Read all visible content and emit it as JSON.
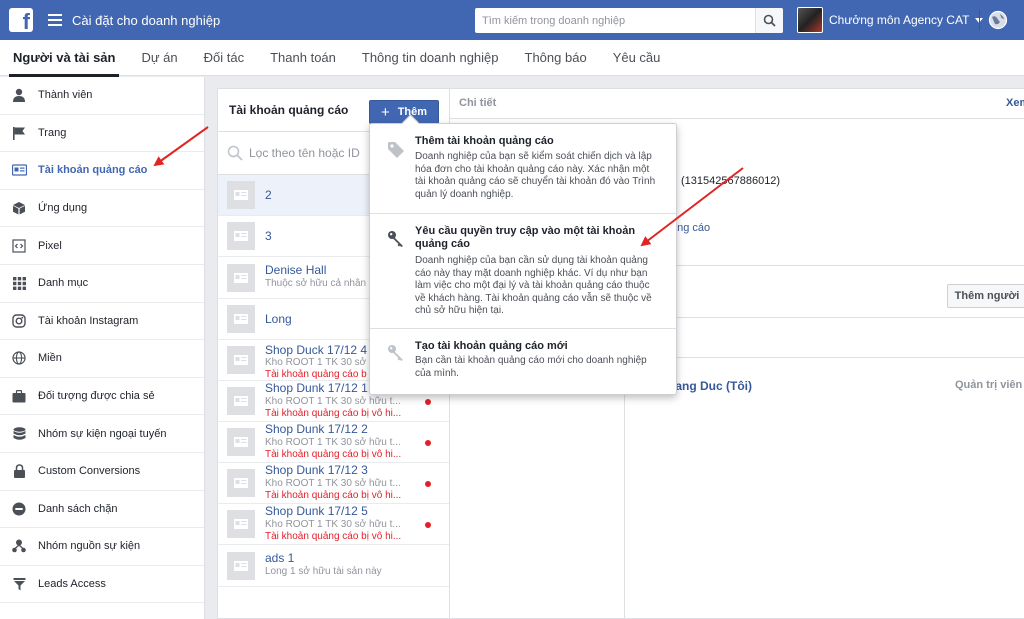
{
  "topbar": {
    "logo_letter": "f",
    "title": "Cài đặt cho doanh nghiệp",
    "search_placeholder": "Tìm kiếm trong doanh nghiệp",
    "profile_name": "Chưởng môn Agency CAT",
    "brand_color": "#4267b2"
  },
  "tabs": [
    "Người và tài sản",
    "Dự án",
    "Đối tác",
    "Thanh toán",
    "Thông tin doanh nghiệp",
    "Thông báo",
    "Yêu cầu"
  ],
  "sidebar": {
    "items": [
      {
        "label": "Thành viên",
        "icon": "person-icon"
      },
      {
        "label": "Trang",
        "icon": "flag-icon"
      },
      {
        "label": "Tài khoản quảng cáo",
        "icon": "ad-account-icon",
        "active": true
      },
      {
        "label": "Ứng dụng",
        "icon": "cube-icon"
      },
      {
        "label": "Pixel",
        "icon": "code-icon"
      },
      {
        "label": "Danh mục",
        "icon": "grid-icon"
      },
      {
        "label": "Tài khoản Instagram",
        "icon": "instagram-icon"
      },
      {
        "label": "Miền",
        "icon": "globe-icon"
      },
      {
        "label": "Đối tượng được chia sẻ",
        "icon": "briefcase-icon"
      },
      {
        "label": "Nhóm sự kiện ngoại tuyến",
        "icon": "database-icon"
      },
      {
        "label": "Custom Conversions",
        "icon": "lock-icon"
      },
      {
        "label": "Danh sách chặn",
        "icon": "block-icon"
      },
      {
        "label": "Nhóm nguồn sự kiện",
        "icon": "network-icon"
      },
      {
        "label": "Leads Access",
        "icon": "funnel-icon"
      }
    ]
  },
  "accounts_panel": {
    "title": "Tài khoản quảng cáo",
    "add_label": "Thêm",
    "filter_placeholder": "Lọc theo tên hoặc ID",
    "accounts": [
      {
        "name": "2"
      },
      {
        "name": "3"
      },
      {
        "name": "Denise Hall",
        "sub": "Thuộc sở hữu cả nhân"
      },
      {
        "name": "Long"
      },
      {
        "name": "Shop Duck 17/12 4",
        "sub": "Kho ROOT 1 TK 30 sở hữu",
        "warn": "Tài khoản quảng cáo b"
      },
      {
        "name": "Shop Dunk 17/12 1",
        "sub": "Kho ROOT 1 TK 30 sở hữu t...",
        "warn": "Tài khoản quảng cáo bị vô hi..."
      },
      {
        "name": "Shop Dunk 17/12 2",
        "sub": "Kho ROOT 1 TK 30 sở hữu t...",
        "warn": "Tài khoản quảng cáo bị vô hi..."
      },
      {
        "name": "Shop Dunk 17/12 3",
        "sub": "Kho ROOT 1 TK 30 sở hữu t...",
        "warn": "Tài khoản quảng cáo bị vô hi..."
      },
      {
        "name": "Shop Dunk 17/12 5",
        "sub": "Kho ROOT 1 TK 30 sở hữu t...",
        "warn": "Tài khoản quảng cáo bị vô hi..."
      },
      {
        "name": "ads 1",
        "sub": "Long 1 sở hữu tài sản này"
      }
    ]
  },
  "details": {
    "title": "Chi tiết",
    "view_link": "Xem",
    "id_text": "(131542567886012)",
    "link_fragment": "ảng cáo",
    "add_person_label": "Thêm người",
    "user_name": "oang Duc (Tôi)",
    "user_role": "Quản trị viên"
  },
  "add_menu": {
    "items": [
      {
        "title": "Thêm tài khoản quảng cáo",
        "desc": "Doanh nghiệp của bạn sẽ kiểm soát chiến dịch và lập hóa đơn cho tài khoản quảng cáo này. Xác nhận một tài khoản quảng cáo sẽ chuyển tài khoản đó vào Trình quản lý doanh nghiệp.",
        "icon": "tag-icon"
      },
      {
        "title": "Yêu cầu quyền truy cập vào một tài khoản quảng cáo",
        "desc": "Doanh nghiệp của bạn cần sử dụng tài khoản quảng cáo này thay mặt doanh nghiệp khác. Ví dụ như bạn làm việc cho một đại lý và tài khoản quảng cáo thuộc về khách hàng. Tài khoản quảng cáo vẫn sẽ thuộc về chủ sở hữu hiện tại.",
        "icon": "key-icon"
      },
      {
        "title": "Tạo tài khoản quảng cáo mới",
        "desc": "Bạn cần tài khoản quảng cáo mới cho doanh nghiệp của mình.",
        "icon": "wrench-icon"
      }
    ]
  },
  "annotation_color": "#e02424"
}
